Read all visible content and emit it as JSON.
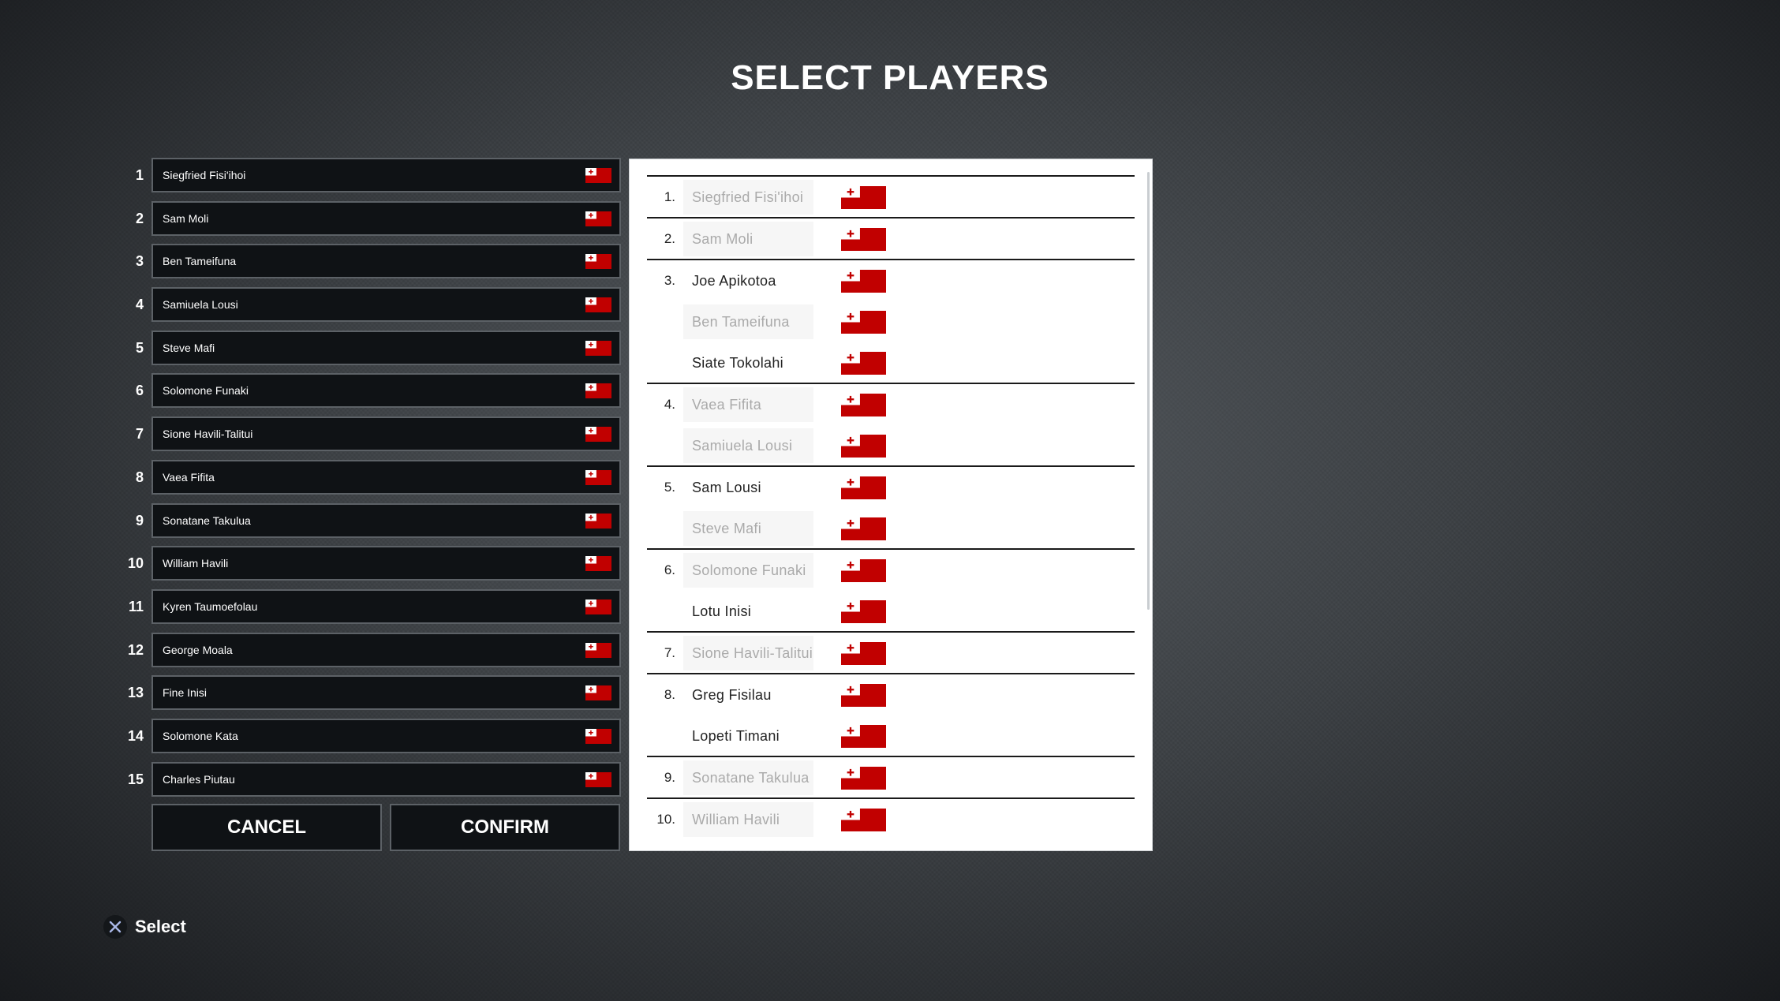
{
  "title": "SELECT PLAYERS",
  "colors": {
    "flag_red": "#c10000",
    "flag_white": "#ffffff",
    "slot_bg": "#0f1215",
    "slot_border": "#5c6166"
  },
  "roster": [
    {
      "num": "1",
      "name": "Siegfried Fisi'ihoi",
      "flag": "tonga-flag-icon"
    },
    {
      "num": "2",
      "name": "Sam Moli",
      "flag": "tonga-flag-icon"
    },
    {
      "num": "3",
      "name": "Ben Tameifuna",
      "flag": "tonga-flag-icon"
    },
    {
      "num": "4",
      "name": "Samiuela Lousi",
      "flag": "tonga-flag-icon"
    },
    {
      "num": "5",
      "name": "Steve Mafi",
      "flag": "tonga-flag-icon"
    },
    {
      "num": "6",
      "name": "Solomone Funaki",
      "flag": "tonga-flag-icon"
    },
    {
      "num": "7",
      "name": "Sione Havili-Talitui",
      "flag": "tonga-flag-icon"
    },
    {
      "num": "8",
      "name": "Vaea Fifita",
      "flag": "tonga-flag-icon"
    },
    {
      "num": "9",
      "name": "Sonatane Takulua",
      "flag": "tonga-flag-icon"
    },
    {
      "num": "10",
      "name": "William Havili",
      "flag": "tonga-flag-icon"
    },
    {
      "num": "11",
      "name": "Kyren Taumoefolau",
      "flag": "tonga-flag-icon"
    },
    {
      "num": "12",
      "name": "George Moala",
      "flag": "tonga-flag-icon"
    },
    {
      "num": "13",
      "name": "Fine Inisi",
      "flag": "tonga-flag-icon"
    },
    {
      "num": "14",
      "name": "Solomone Kata",
      "flag": "tonga-flag-icon"
    },
    {
      "num": "15",
      "name": "Charles Piutau",
      "flag": "tonga-flag-icon"
    }
  ],
  "buttons": {
    "cancel": "CANCEL",
    "confirm": "CONFIRM"
  },
  "depth_chart": [
    {
      "position": "1.",
      "players": [
        {
          "name": "Siegfried Fisi'ihoi",
          "selected": true
        }
      ]
    },
    {
      "position": "2.",
      "players": [
        {
          "name": "Sam Moli",
          "selected": true
        }
      ]
    },
    {
      "position": "3.",
      "players": [
        {
          "name": "Joe Apikotoa",
          "selected": false
        },
        {
          "name": "Ben Tameifuna",
          "selected": true
        },
        {
          "name": "Siate Tokolahi",
          "selected": false
        }
      ]
    },
    {
      "position": "4.",
      "players": [
        {
          "name": "Vaea Fifita",
          "selected": true
        },
        {
          "name": "Samiuela Lousi",
          "selected": true
        }
      ]
    },
    {
      "position": "5.",
      "players": [
        {
          "name": "Sam Lousi",
          "selected": false
        },
        {
          "name": "Steve Mafi",
          "selected": true
        }
      ]
    },
    {
      "position": "6.",
      "players": [
        {
          "name": "Solomone Funaki",
          "selected": true
        },
        {
          "name": "Lotu Inisi",
          "selected": false
        }
      ]
    },
    {
      "position": "7.",
      "players": [
        {
          "name": "Sione Havili-Talitui",
          "selected": true
        }
      ]
    },
    {
      "position": "8.",
      "players": [
        {
          "name": "Greg Fisilau",
          "selected": false
        },
        {
          "name": "Lopeti Timani",
          "selected": false
        }
      ]
    },
    {
      "position": "9.",
      "players": [
        {
          "name": "Sonatane Takulua",
          "selected": true
        }
      ]
    },
    {
      "position": "10.",
      "players": [
        {
          "name": "William Havili",
          "selected": true
        }
      ]
    }
  ],
  "hint": {
    "icon": "cross-button-icon",
    "label": "Select"
  }
}
